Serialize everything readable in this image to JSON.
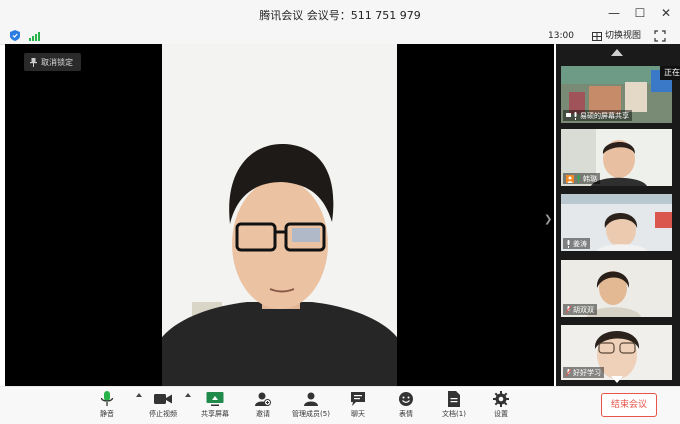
{
  "window": {
    "title": "腾讯会议 会议号：511 751 979"
  },
  "statusbar": {
    "time": "13:00",
    "switch_view": "切换视图"
  },
  "main": {
    "unpin_label": "取消锁定"
  },
  "gallery": {
    "speaking_label": "正在",
    "participants": [
      {
        "name": "易硕的屏幕共享"
      },
      {
        "name": "韩璐"
      },
      {
        "name": "姜涛"
      },
      {
        "name": "胡双双"
      },
      {
        "name": "好好学习"
      }
    ]
  },
  "controls": {
    "mute": "静音",
    "stop_video": "停止视频",
    "share_screen": "共享屏幕",
    "invite": "邀请",
    "manage_members": "管理成员(5)",
    "chat": "聊天",
    "reactions": "表情",
    "documents": "文档(1)",
    "settings": "设置",
    "end_meeting": "结束会议"
  },
  "colors": {
    "accent_green": "#28b24a",
    "end_red": "#e8544a",
    "shield_blue": "#2b7de1"
  }
}
